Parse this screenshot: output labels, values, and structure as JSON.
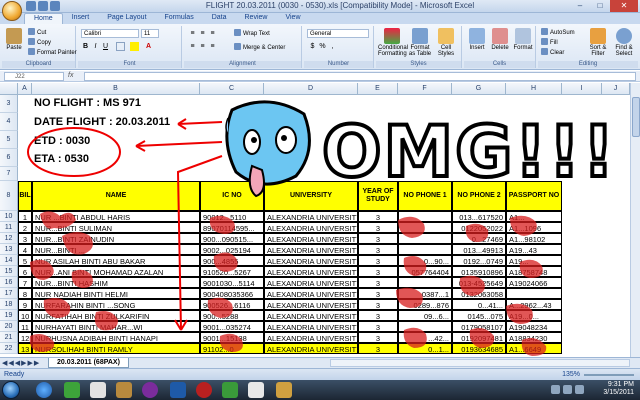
{
  "window": {
    "title": "FLIGHT 20.03.2011 (0030 - 0530).xls [Compatibility Mode] - Microsoft Excel"
  },
  "ribbon": {
    "tabs": [
      "Home",
      "Insert",
      "Page Layout",
      "Formulas",
      "Data",
      "Review",
      "View"
    ],
    "clipboard": {
      "paste": "Paste",
      "cut": "Cut",
      "copy": "Copy",
      "format_painter": "Format Painter",
      "label": "Clipboard"
    },
    "font": {
      "name": "Calibri",
      "size": "11",
      "label": "Font"
    },
    "alignment": {
      "wrap": "Wrap Text",
      "merge": "Merge & Center",
      "label": "Alignment"
    },
    "number": {
      "format": "General",
      "label": "Number"
    },
    "styles": {
      "conditional": "Conditional Formatting",
      "format_table": "Format as Table",
      "cell_styles": "Cell Styles",
      "label": "Styles"
    },
    "cells": {
      "insert": "Insert",
      "delete": "Delete",
      "format": "Format",
      "label": "Cells"
    },
    "editing": {
      "autosum": "AutoSum",
      "fill": "Fill",
      "clear": "Clear",
      "sort": "Sort & Filter",
      "find": "Find & Select",
      "label": "Editing"
    }
  },
  "formula_bar": {
    "name_box": "J22",
    "fx": "fx",
    "value": ""
  },
  "columns": [
    "A",
    "B",
    "C",
    "D",
    "E",
    "F",
    "G",
    "H",
    "I",
    "J"
  ],
  "info": {
    "flight": "NO FLIGHT : MS 971",
    "date": "DATE FLIGHT : 20.03.2011",
    "etd": "ETD : 0030",
    "eta": "ETA : 0530"
  },
  "overlay_text": "OMG!!!",
  "table": {
    "headers": [
      "BIL",
      "NAME",
      "IC NO",
      "UNIVERSITY",
      "YEAR OF STUDY",
      "NO PHONE 1",
      "NO PHONE 2",
      "PASSPORT NO"
    ],
    "rows": [
      {
        "bil": "1",
        "name": "NUR ...BINTI ABDUL HARIS",
        "ic": "90012...5110",
        "uni": "ALEXANDRIA UNIVERSITY",
        "year": "3",
        "p1": "",
        "p2": "013...617520",
        "pass": "A1..."
      },
      {
        "bil": "2",
        "name": "NUR...BINTI SULIMAN",
        "ic": "89070114595...",
        "uni": "ALEXANDRIA UNIVERSITY",
        "year": "3",
        "p1": "",
        "p2": "0122052022",
        "pass": "A1...1096"
      },
      {
        "bil": "3",
        "name": "NUR...BINTI ZAINUDIN",
        "ic": "900...090515...",
        "uni": "ALEXANDRIA UNIVERSITY",
        "year": "3",
        "p1": "",
        "p2": "0...27469",
        "pass": "A1...98102"
      },
      {
        "bil": "4",
        "name": "NUR...BINTI ...",
        "ic": "9002...025194",
        "uni": "ALEXANDRIA UNIVERSITY",
        "year": "3",
        "p1": "",
        "p2": "013...49913",
        "pass": "A19...43"
      },
      {
        "bil": "5",
        "name": "NUR ASILAH BINTI ABU BAKAR",
        "ic": "900...4855",
        "uni": "ALEXANDRIA UNIVERSITY",
        "year": "3",
        "p1": "0...90...",
        "p2": "0192...0749",
        "pass": "A19..."
      },
      {
        "bil": "6",
        "name": "NUR...ANI BINTI MOHAMAD AZALAN",
        "ic": "910520...5267",
        "uni": "ALEXANDRIA UNIVERSITY",
        "year": "3",
        "p1": "057764404",
        "p2": "0135910896",
        "pass": "A18758748"
      },
      {
        "bil": "7",
        "name": "NUR...BINTI HASHIM",
        "ic": "9001030...5114",
        "uni": "ALEXANDRIA UNIVERSITY",
        "year": "3",
        "p1": "",
        "p2": "013-4525649",
        "pass": "A19024066"
      },
      {
        "bil": "8",
        "name": "NUR NADIAH BINTI HELMI",
        "ic": "900408035366",
        "uni": "ALEXANDRIA UNIVERSITY",
        "year": "3",
        "p1": "0387...1",
        "p2": "0132063058",
        "pass": ""
      },
      {
        "bil": "9",
        "name": "NURFARAHIN BINTI ...SONG",
        "ic": "900526...6116",
        "uni": "ALEXANDRIA UNIVERSITY",
        "year": "3",
        "p1": "0289...876",
        "p2": "0...41...",
        "pass": "A...2962...43"
      },
      {
        "bil": "10",
        "name": "NURFATIHAH BINTI ZULKARIFIN",
        "ic": "900...5288",
        "uni": "ALEXANDRIA UNIVERSITY",
        "year": "3",
        "p1": "09...6...",
        "p2": "0145...075",
        "pass": "A19...0..."
      },
      {
        "bil": "11",
        "name": "NURHAYATI BINTI MAHAR...WI",
        "ic": "9001...035274",
        "uni": "ALEXANDRIA UNIVERSITY",
        "year": "3",
        "p1": "",
        "p2": "0179058107",
        "pass": "A19048234"
      },
      {
        "bil": "12",
        "name": "NURHUSNA ADIBAH BINTI HANAPI",
        "ic": "9001...15138",
        "uni": "ALEXANDRIA UNIVERSITY",
        "year": "3",
        "p1": "...42...",
        "p2": "0192097481",
        "pass": "A18834230"
      },
      {
        "bil": "13",
        "name": "NURSOLIHAH BINTI RAMLY",
        "ic": "91102...0",
        "uni": "ALEXANDRIA UNIVERSITY",
        "year": "3",
        "p1": "0...1...",
        "p2": "0193634685",
        "pass": "A1...6649"
      }
    ]
  },
  "sheet_tab": "20.03.2011 (68PAX)",
  "status": {
    "ready": "Ready",
    "zoom": "135%"
  },
  "taskbar": {
    "time": "9:31 PM",
    "date": "3/15/2011"
  }
}
